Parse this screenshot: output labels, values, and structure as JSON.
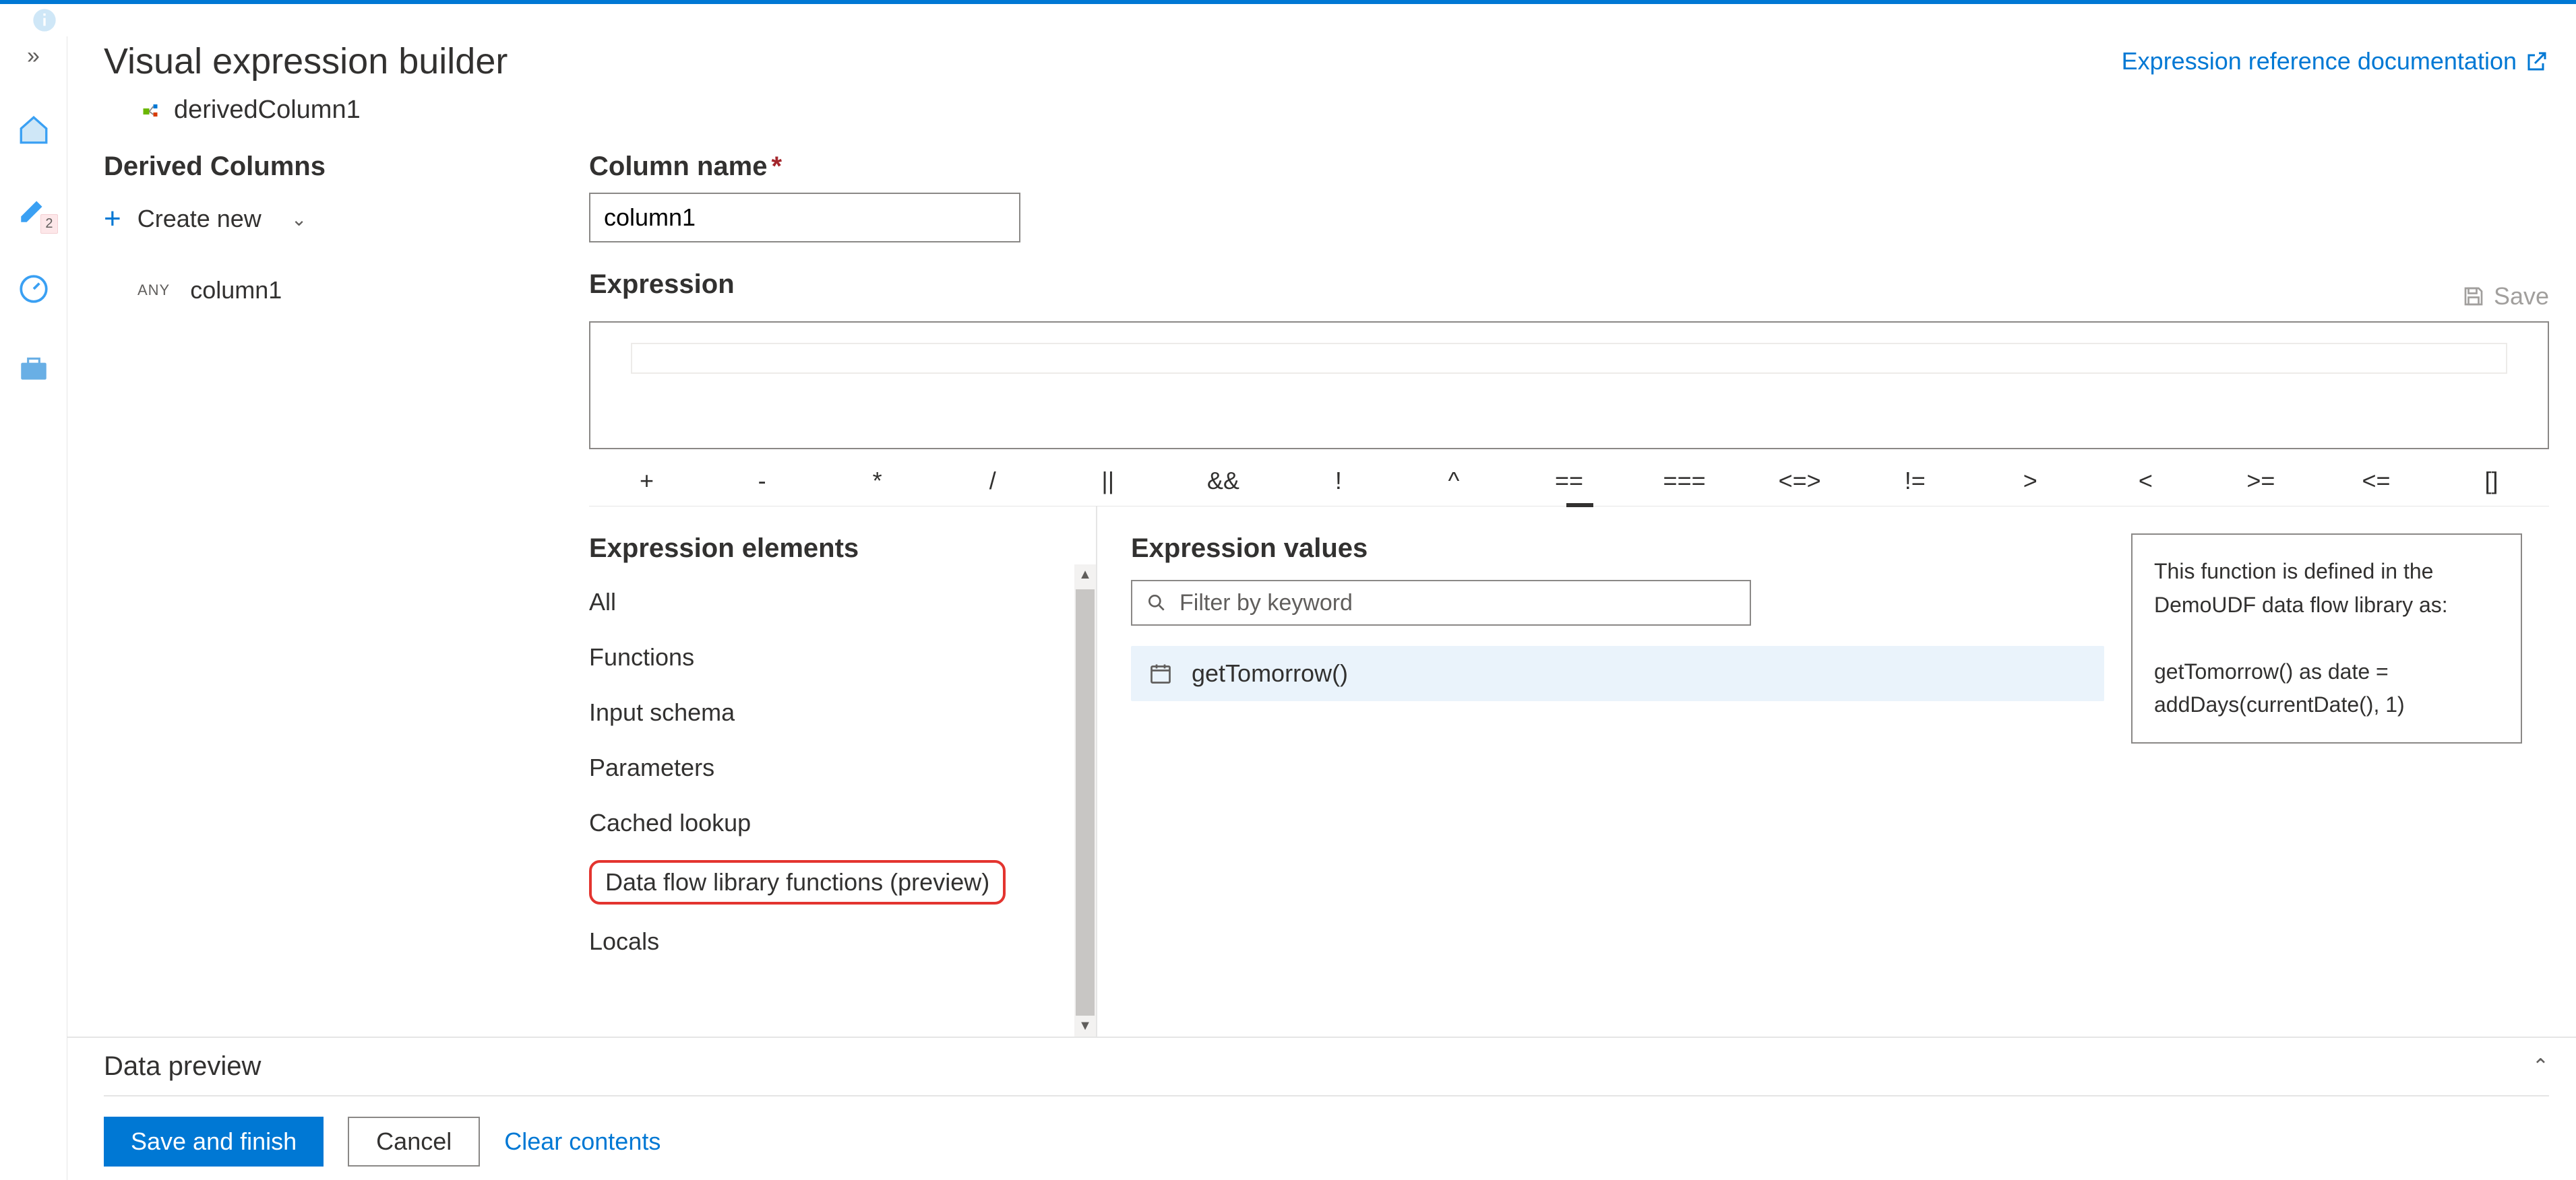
{
  "header": {
    "title": "Visual expression builder",
    "reference_link": "Expression reference documentation",
    "node_name": "derivedColumn1"
  },
  "sidebar_rail": {
    "badge_count": "2"
  },
  "derived_columns": {
    "heading": "Derived Columns",
    "create_new": "Create new",
    "items": [
      {
        "type_badge": "ANY",
        "name": "column1"
      }
    ]
  },
  "column_form": {
    "name_label": "Column name",
    "name_value": "column1",
    "expression_label": "Expression",
    "save_label": "Save"
  },
  "operators": [
    "+",
    "-",
    "*",
    "/",
    "||",
    "&&",
    "!",
    "^",
    "==",
    "===",
    "<=>",
    "!=",
    ">",
    "<",
    ">=",
    "<=",
    "[]"
  ],
  "expression_elements": {
    "heading": "Expression elements",
    "items": [
      "All",
      "Functions",
      "Input schema",
      "Parameters",
      "Cached lookup",
      "Data flow library functions (preview)",
      "Locals"
    ],
    "highlighted_index": 5
  },
  "expression_values": {
    "heading": "Expression values",
    "filter_placeholder": "Filter by keyword",
    "items": [
      {
        "name": "getTomorrow()"
      }
    ]
  },
  "tooltip": {
    "line1": "This function is defined in the DemoUDF data flow library as:",
    "line2": "getTomorrow() as date = addDays(currentDate(), 1)"
  },
  "footer": {
    "data_preview": "Data preview",
    "save_and_finish": "Save and finish",
    "cancel": "Cancel",
    "clear_contents": "Clear contents"
  }
}
